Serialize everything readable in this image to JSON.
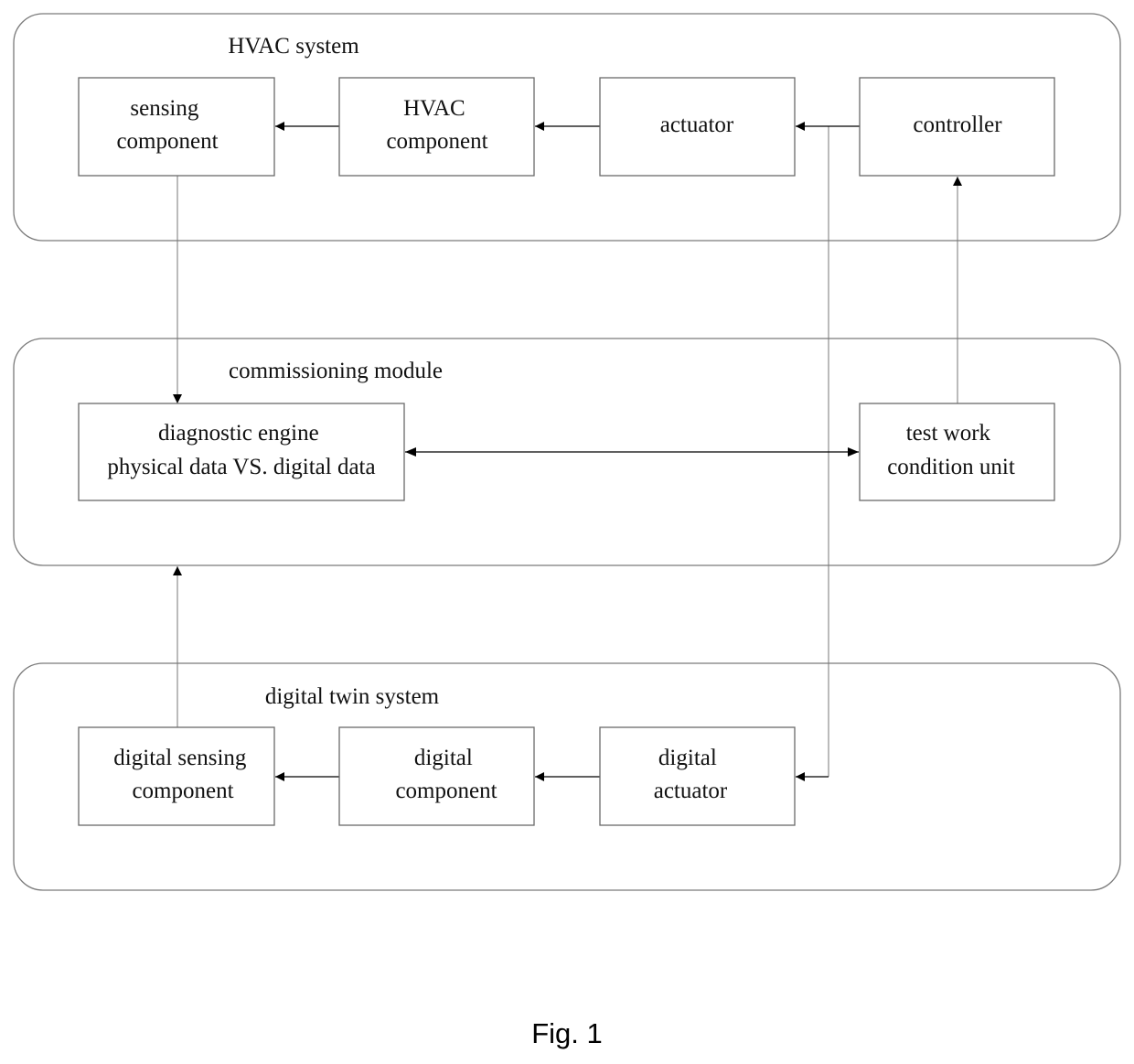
{
  "groups": {
    "hvac": {
      "title": "HVAC system"
    },
    "commissioning": {
      "title": "commissioning module"
    },
    "twin": {
      "title": "digital twin system"
    }
  },
  "boxes": {
    "sensing": [
      "sensing",
      "component"
    ],
    "hvac_component": [
      "HVAC",
      "component"
    ],
    "actuator": [
      "actuator"
    ],
    "controller": [
      "controller"
    ],
    "diagnostic": [
      "diagnostic engine",
      "physical data VS. digital data"
    ],
    "test_unit": [
      "test work",
      "condition unit"
    ],
    "digital_sensing": [
      "digital sensing",
      "component"
    ],
    "digital_component": [
      "digital",
      "component"
    ],
    "digital_actuator": [
      "digital",
      "actuator"
    ]
  },
  "connections": [
    {
      "from": "hvac_component",
      "to": "sensing"
    },
    {
      "from": "actuator",
      "to": "hvac_component"
    },
    {
      "from": "controller",
      "to": "actuator"
    },
    {
      "from": "sensing",
      "to": "diagnostic"
    },
    {
      "from": "test_unit",
      "to": "controller"
    },
    {
      "from": "diagnostic",
      "to": "test_unit",
      "bidirectional": true
    },
    {
      "from": "digital_sensing",
      "to": "commissioning"
    },
    {
      "from": "digital_component",
      "to": "digital_sensing"
    },
    {
      "from": "digital_actuator",
      "to": "digital_component"
    },
    {
      "from": "controller",
      "to": "digital_actuator"
    }
  ],
  "caption": "Fig. 1"
}
